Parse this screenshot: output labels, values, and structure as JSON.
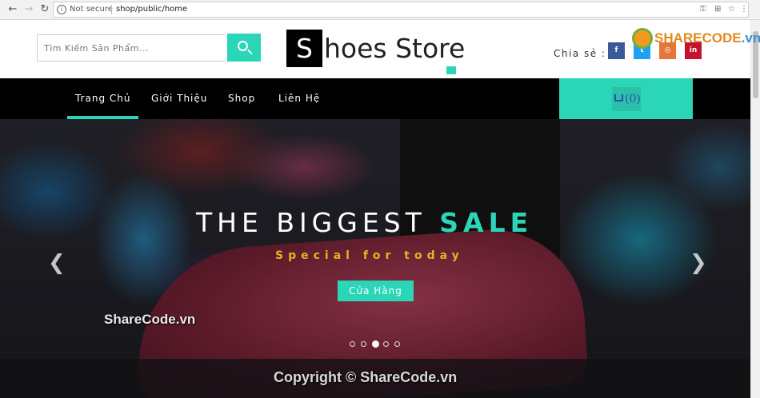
{
  "browser": {
    "security_label": "Not secure",
    "url": "shop/public/home"
  },
  "header": {
    "search_placeholder": "Tìm Kiếm Sản Phẩm...",
    "logo_letter": "S",
    "logo_rest": "hoes Store",
    "share_label": "Chia sẻ :",
    "social": [
      {
        "icon": "facebook-icon",
        "glyph": "f",
        "color": "#3b5998"
      },
      {
        "icon": "twitter-icon",
        "glyph": "t",
        "color": "#1da1f2"
      },
      {
        "icon": "instagram-icon",
        "glyph": "◎",
        "color": "#e4763a"
      },
      {
        "icon": "linkedin-icon",
        "glyph": "in",
        "color": "#c4122f"
      }
    ]
  },
  "menu": {
    "items": [
      {
        "label": "Trang Chủ",
        "active": true
      },
      {
        "label": "Giới Thiệu",
        "active": false
      },
      {
        "label": "Shop",
        "active": false
      },
      {
        "label": "Liên Hệ",
        "active": false
      }
    ],
    "cart_count": "(0)"
  },
  "hero": {
    "title_main": "THE BIGGEST ",
    "title_accent": "SALE",
    "subtitle": "Special for today",
    "button_label": "Cửa Hàng",
    "slide_count": 5,
    "active_slide": 2
  },
  "watermarks": {
    "brand_left": "SHARE",
    "brand_right": "CODE",
    "brand_suffix": ".vn",
    "left": "ShareCode.vn",
    "bottom": "Copyright © ShareCode.vn"
  },
  "colors": {
    "accent": "#2ad6b7",
    "subtitle": "#e5b321",
    "menu_bg": "#000000"
  }
}
